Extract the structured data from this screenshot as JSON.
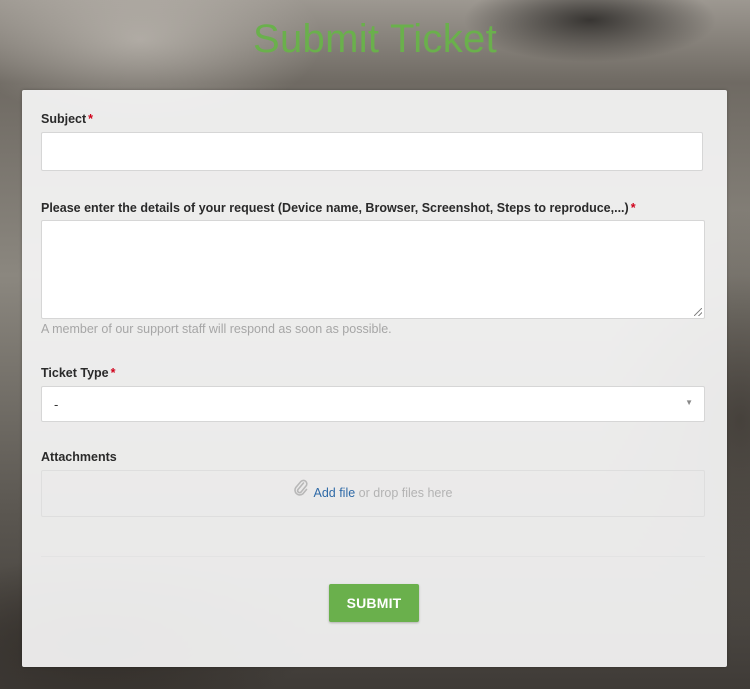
{
  "page": {
    "title": "Submit Ticket"
  },
  "form": {
    "subject": {
      "label": "Subject",
      "required_mark": "*",
      "value": ""
    },
    "details": {
      "label": "Please enter the details of your request (Device name, Browser, Screenshot, Steps to reproduce,...)",
      "required_mark": "*",
      "value": "",
      "hint": "A member of our support staff will respond as soon as possible."
    },
    "ticket_type": {
      "label": "Ticket Type",
      "required_mark": "*",
      "selected": "-",
      "arrow_icon": "triangle-down-icon"
    },
    "attachments": {
      "label": "Attachments",
      "icon": "paperclip-icon",
      "add_file": "Add file",
      "drop_text": " or drop files here"
    },
    "submit_label": "SUBMIT"
  },
  "colors": {
    "accent": "#6ab04c",
    "link": "#2f6aa7",
    "required": "#d0021b"
  }
}
